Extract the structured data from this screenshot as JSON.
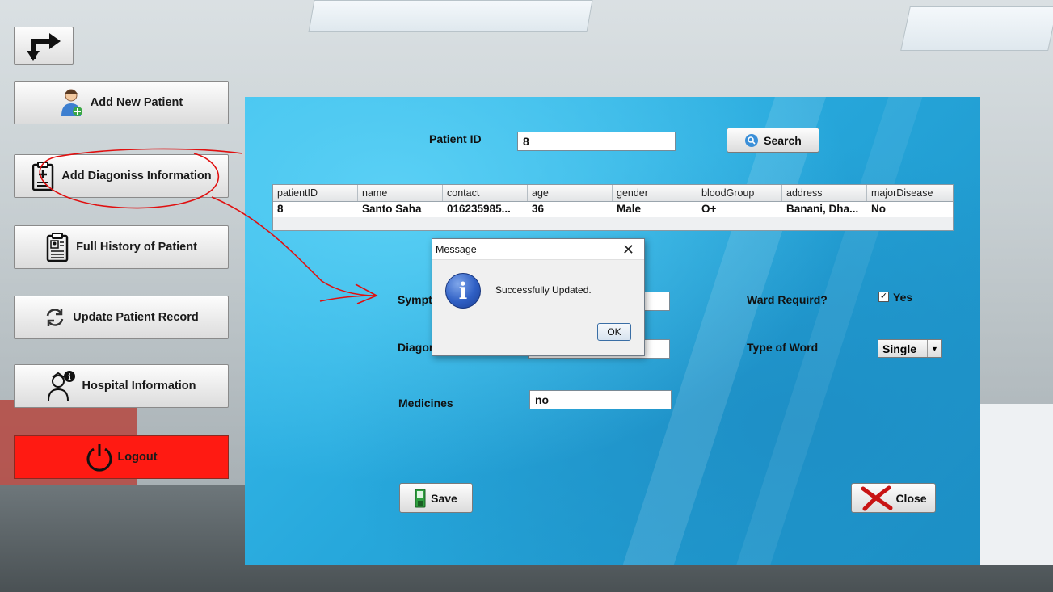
{
  "sidebar": {
    "back_icon": "turn-arrow-icon",
    "items": [
      {
        "label": "Add New Patient",
        "icon": "patient-add-icon"
      },
      {
        "label": "Add Diagoniss Information",
        "icon": "clipboard-plus-icon"
      },
      {
        "label": "Full History of Patient",
        "icon": "id-clipboard-icon"
      },
      {
        "label": "Update Patient Record",
        "icon": "refresh-icon"
      },
      {
        "label": "Hospital Information",
        "icon": "nurse-info-icon"
      }
    ],
    "logout": {
      "label": "Logout",
      "icon": "power-icon",
      "color": "#ff1a12"
    }
  },
  "search": {
    "label": "Patient ID",
    "value": "8",
    "button_label": "Search",
    "button_icon": "search-icon"
  },
  "table": {
    "columns": [
      "patientID",
      "name",
      "contact",
      "age",
      "gender",
      "bloodGroup",
      "address",
      "majorDisease"
    ],
    "rows": [
      [
        "8",
        "Santo Saha",
        "016235985...",
        "36",
        "Male",
        "O+",
        "Banani, Dha...",
        "No"
      ]
    ]
  },
  "form": {
    "symptom_label": "Sympt",
    "symptom_value": "",
    "diagnosis_label": "Diagor",
    "diagnosis_value": "",
    "medicines_label": "Medicines",
    "medicines_value": "no",
    "ward_label": "Ward Requird?",
    "ward_checked": true,
    "ward_option": "Yes",
    "ward_type_label": "Type of Word",
    "ward_type_value": "Single",
    "save_label": "Save",
    "close_label": "Close"
  },
  "dialog": {
    "title": "Message",
    "message": "Successfully Updated.",
    "ok_label": "OK",
    "icon": "info-icon"
  },
  "colors": {
    "panel_blue": "#27a8dc",
    "annotation_red": "#e01010",
    "logout_red": "#ff1a12"
  }
}
